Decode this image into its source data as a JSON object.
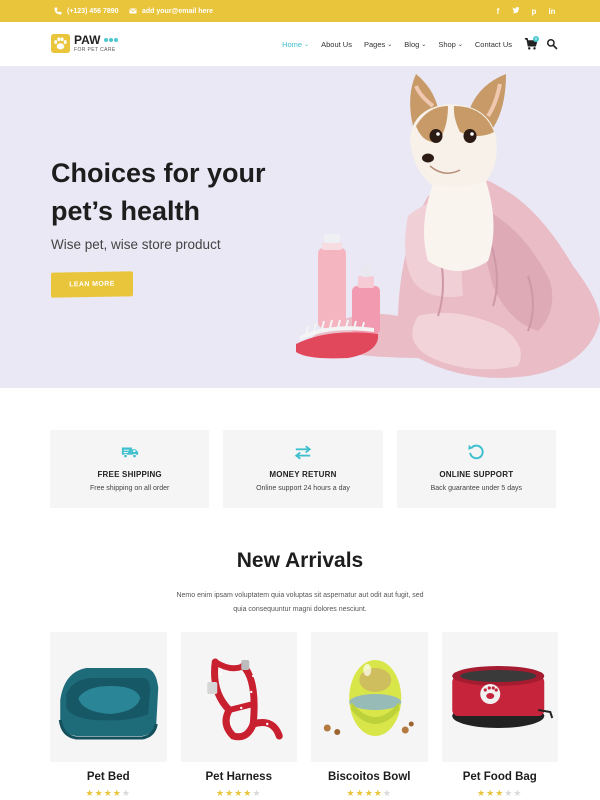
{
  "topbar": {
    "phone": "(+123) 456 7890",
    "email": "add your@email here",
    "social_icons": [
      "facebook-icon",
      "twitter-icon",
      "pinterest-icon",
      "linkedin-icon"
    ]
  },
  "header": {
    "logo_name": "PAW",
    "logo_tagline": "FOR PET CARE",
    "nav": [
      {
        "label": "Home",
        "active": true
      },
      {
        "label": "About Us",
        "active": false
      },
      {
        "label": "Pages",
        "active": false
      },
      {
        "label": "Blog",
        "active": false
      },
      {
        "label": "Shop",
        "active": false
      },
      {
        "label": "Contact Us",
        "active": false
      }
    ],
    "cart_count": "0"
  },
  "hero": {
    "title": "Choices for your pet’s health",
    "subtitle": "Wise pet, wise store product",
    "button_label": "LEAN MORE"
  },
  "features": [
    {
      "title": "FREE SHIPPING",
      "desc": "Free shipping on all order",
      "icon": "truck-icon"
    },
    {
      "title": "MONEY RETURN",
      "desc": "Online support 24 hours a day",
      "icon": "exchange-arrows-icon"
    },
    {
      "title": "ONLINE SUPPORT",
      "desc": "Back guarantee under 5 days",
      "icon": "undo-icon"
    }
  ],
  "new_arrivals": {
    "title": "New Arrivals",
    "desc": "Nemo enim ipsam voluptatem quia voluptas sit aspernatur aut odit aut fugit, sed quia consequuntur magni dolores nesciunt."
  },
  "products": [
    {
      "name": "Pet Bed",
      "rating": 4
    },
    {
      "name": "Pet Harness",
      "rating": 4
    },
    {
      "name": "Biscoitos Bowl",
      "rating": 4
    },
    {
      "name": "Pet Food Bag",
      "rating": 3
    }
  ],
  "colors": {
    "accent_yellow": "#e9c53c",
    "accent_teal": "#3dbfcd",
    "hero_bg": "#e9e8f4",
    "card_bg": "#f5f5f5"
  }
}
